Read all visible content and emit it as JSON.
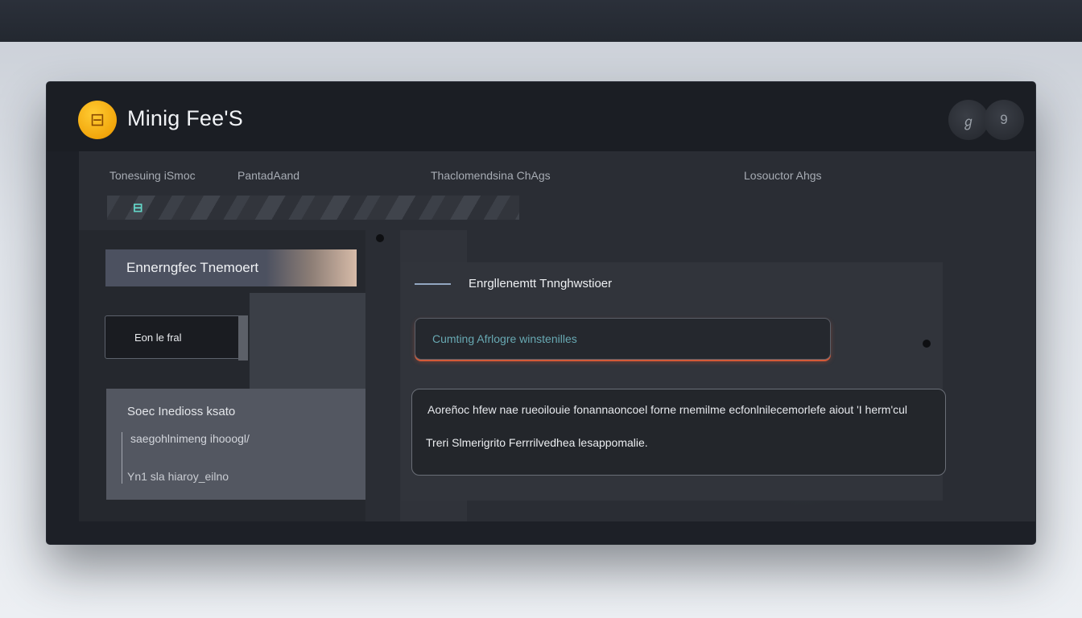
{
  "app": {
    "title": "Minig Fee'S",
    "logo_icon": "coin-icon",
    "accent_color": "#f2a60c"
  },
  "window_controls": [
    {
      "glyph": "ℊ",
      "icon": "user-icon"
    },
    {
      "glyph": "9",
      "icon": "settings-icon"
    }
  ],
  "columns": [
    "Tonesuing iSmoc",
    "PantadAand",
    "Thaclomendsina ChAgs",
    "Losouctor Ahgs"
  ],
  "filter_bar": {
    "tab_icon_glyph": "⊟"
  },
  "left": {
    "primary_button": "Ennerngfec Tnemoert",
    "select_value": "Eon le fral",
    "card": {
      "title": "Soec Inedioss ksato",
      "subtitle": "saegohlnimeng ihooogl/",
      "footer": "Yn1 sla hiaroy_eilno"
    }
  },
  "right": {
    "title": "Enrgllenemtt Tnnghwstioer",
    "input_value": "Cumting Afrlogre winstenilles",
    "textarea_line1": "Aoreñoc hfew nae rueoilouie fonannaoncoel forne rnemilme ecfonlnilecemorlefe aiout 'I herm'cul",
    "textarea_line2": "Treri Slmerigrito Ferrrilvedhea lesappomalie."
  },
  "colors": {
    "accent_input_underline": "#d45a38",
    "teal_text": "#68a9b3",
    "panel_bg": "#2a2d34"
  }
}
